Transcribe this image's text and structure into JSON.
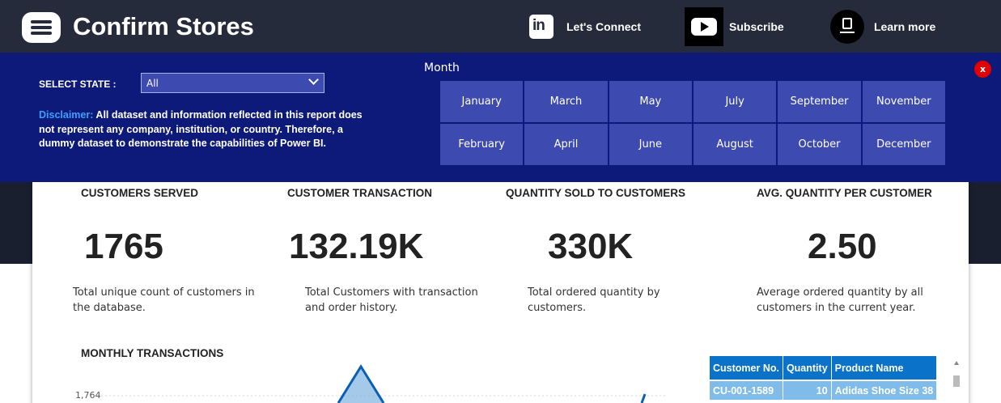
{
  "header": {
    "title": "Confirm Stores",
    "links": [
      {
        "label": "Let's Connect",
        "icon": "linkedin-icon"
      },
      {
        "label": "Subscribe",
        "icon": "youtube-icon"
      },
      {
        "label": "Learn more",
        "icon": "presentation-icon"
      }
    ]
  },
  "filters": {
    "state_label": "SELECT STATE :",
    "state_value": "All",
    "disclaimer_heading": "Disclaimer:",
    "disclaimer_text": " All dataset and information reflected in this report does not represent any company, institution, or country. Therefore, a dummy dataset to demonstrate the capabilities of Power BI.",
    "month_title": "Month",
    "months": [
      "January",
      "March",
      "May",
      "July",
      "September",
      "November",
      "February",
      "April",
      "June",
      "August",
      "October",
      "December"
    ],
    "close_label": "x"
  },
  "kpis": [
    {
      "title": "CUSTOMERS SERVED",
      "value": "1765",
      "desc": "Total unique count of customers in the database."
    },
    {
      "title": "CUSTOMER TRANSACTION",
      "value": "132.19K",
      "desc": "Total Customers with transaction and order history."
    },
    {
      "title": "QUANTITY SOLD TO CUSTOMERS",
      "value": "330K",
      "desc": "Total ordered quantity by customers."
    },
    {
      "title": "AVG. QUANTITY PER CUSTOMER",
      "value": "2.50",
      "desc": "Average ordered quantity by all customers in the current year."
    }
  ],
  "monthly": {
    "title": "MONTHLY TRANSACTIONS",
    "ytick": "1,764"
  },
  "table": {
    "columns": [
      "Customer No.",
      "Quantity",
      "Product Name"
    ],
    "rows": [
      [
        "CU-001-1589",
        "10",
        "Adidas Shoe Size 38"
      ]
    ]
  },
  "colors": {
    "header_bg": "#262b3b",
    "filter_bg": "#0e1a7a",
    "month_button": "#3d4ab0",
    "table_header": "#0a72c8",
    "table_row": "#7fbcea",
    "close_button": "#e30000"
  }
}
